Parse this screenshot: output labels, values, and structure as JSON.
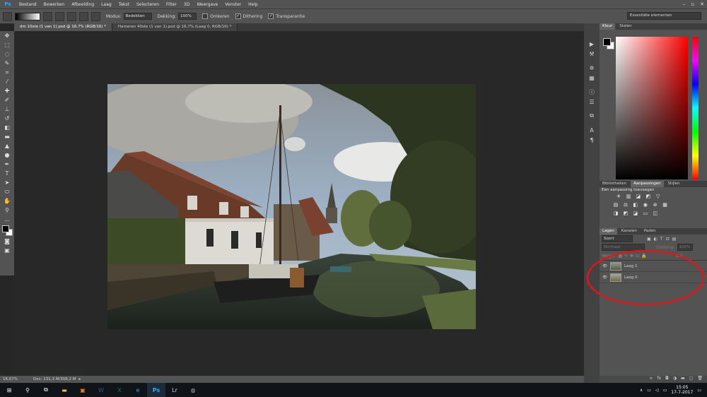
{
  "app": {
    "logo": "Ps",
    "brand_color": "#31a8ff"
  },
  "menu": [
    "Bestand",
    "Bewerken",
    "Afbeelding",
    "Laag",
    "Tekst",
    "Selecteren",
    "Filter",
    "3D",
    "Weergave",
    "Venster",
    "Help"
  ],
  "window_controls": [
    "–",
    "▫",
    "✕"
  ],
  "options": {
    "mode_label": "Modus:",
    "mode_value": "Bedekken",
    "opacity_label": "Dekking:",
    "opacity_value": "100%",
    "reverse_label": "Omkeren",
    "dither_label": "Dithering",
    "transparency_label": "Transparantie",
    "workspace": "Essentiële elementen"
  },
  "tabs": [
    {
      "label": "dm 10ste (1 van 1).psd @ 16,7% (RGB/16) *"
    },
    {
      "label": "Hameren 40ste (1 van 1).psd @ 16,7% (Laag 0, RGB/16) *"
    }
  ],
  "status": {
    "zoom": "16,67%",
    "doc": "Doc: 131,3 M/306,2 M"
  },
  "panels": {
    "color_tabs": [
      "Kleur",
      "Stalen"
    ],
    "adj_tabs": [
      "Bibliotheken",
      "Aanpassingen",
      "Stijlen"
    ],
    "adj_title": "Een aanpassing toevoegen",
    "layers_tabs": [
      "Lagen",
      "Kanalen",
      "Paden"
    ],
    "layer_kind": "Soort",
    "blend_mode": "Normaal",
    "opacity_label": "Dekking:",
    "opacity_value": "100%",
    "lock_label": "Vergr.:",
    "fill_label": "Vul:",
    "layers": [
      {
        "name": "Laag 1"
      },
      {
        "name": "Laag 0"
      }
    ]
  },
  "annotation": {
    "color": "#e0161b"
  },
  "taskbar": {
    "time": "15:05",
    "date": "17-7-2017"
  },
  "icons": [
    "move-icon",
    "marquee-icon",
    "lasso-icon",
    "quick-select-icon",
    "crop-icon",
    "eyedropper-icon",
    "healing-icon",
    "brush-icon",
    "stamp-icon",
    "history-brush-icon",
    "eraser-icon",
    "gradient-icon",
    "blur-icon",
    "dodge-icon",
    "pen-icon",
    "type-icon",
    "path-select-icon",
    "shape-icon",
    "hand-icon",
    "zoom-icon"
  ]
}
